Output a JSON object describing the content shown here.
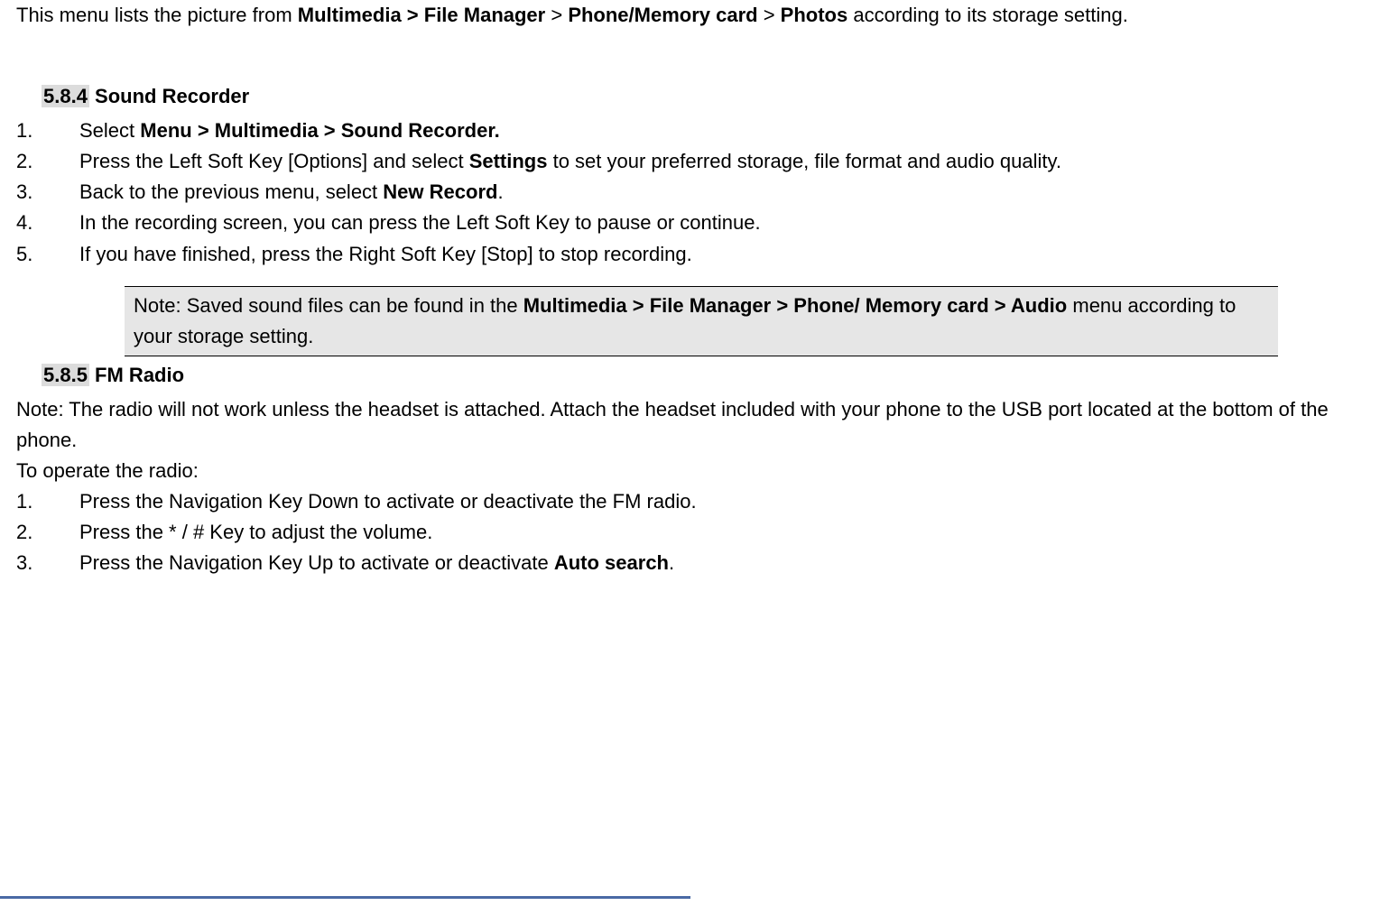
{
  "intro": {
    "t1": "This menu lists the picture from ",
    "b1": "Multimedia > File Manager",
    "t2": " > ",
    "b2": "Phone/Memory card",
    "t3": " > ",
    "b3": "Photos",
    "t4": " according to its storage setting."
  },
  "s1": {
    "num": "5.8.4",
    "title": " Sound Recorder",
    "items": [
      {
        "n": "1.",
        "pre": "Select ",
        "b": "Menu > Multimedia > Sound Recorder.",
        "post": ""
      },
      {
        "n": "2.",
        "pre": "Press the Left Soft Key [Options] and select ",
        "b": "Settings",
        "post": " to set your preferred storage, file format and audio quality."
      },
      {
        "n": "3.",
        "pre": "Back to the previous menu, select ",
        "b": "New Record",
        "post": "."
      },
      {
        "n": "4.",
        "pre": "In the recording screen, you can press the Left Soft Key to pause or continue.",
        "b": "",
        "post": ""
      },
      {
        "n": "5.",
        "pre": "If you have finished, press the Right Soft Key [Stop] to stop recording.",
        "b": "",
        "post": ""
      }
    ],
    "note": {
      "t1": "Note: Saved sound files can be found in the ",
      "b1": "Multimedia > File Manager > Phone/ Memory card > Audio",
      "t2": " menu according to your storage setting."
    }
  },
  "s2": {
    "num": "5.8.5",
    "title": " FM Radio",
    "note": "Note: The radio will not work unless the headset is attached. Attach the headset included with your phone to the USB port located at the bottom of the phone.",
    "lead": "To operate the radio:",
    "items": [
      {
        "n": "1.",
        "pre": "Press the Navigation Key Down to activate or deactivate the FM radio.",
        "b": "",
        "post": ""
      },
      {
        "n": "2.",
        "pre": "Press the * / # Key to adjust the volume.",
        "b": "",
        "post": ""
      },
      {
        "n": "3.",
        "pre": "Press the Navigation Key Up to activate or deactivate ",
        "b": "Auto search",
        "post": "."
      }
    ]
  }
}
